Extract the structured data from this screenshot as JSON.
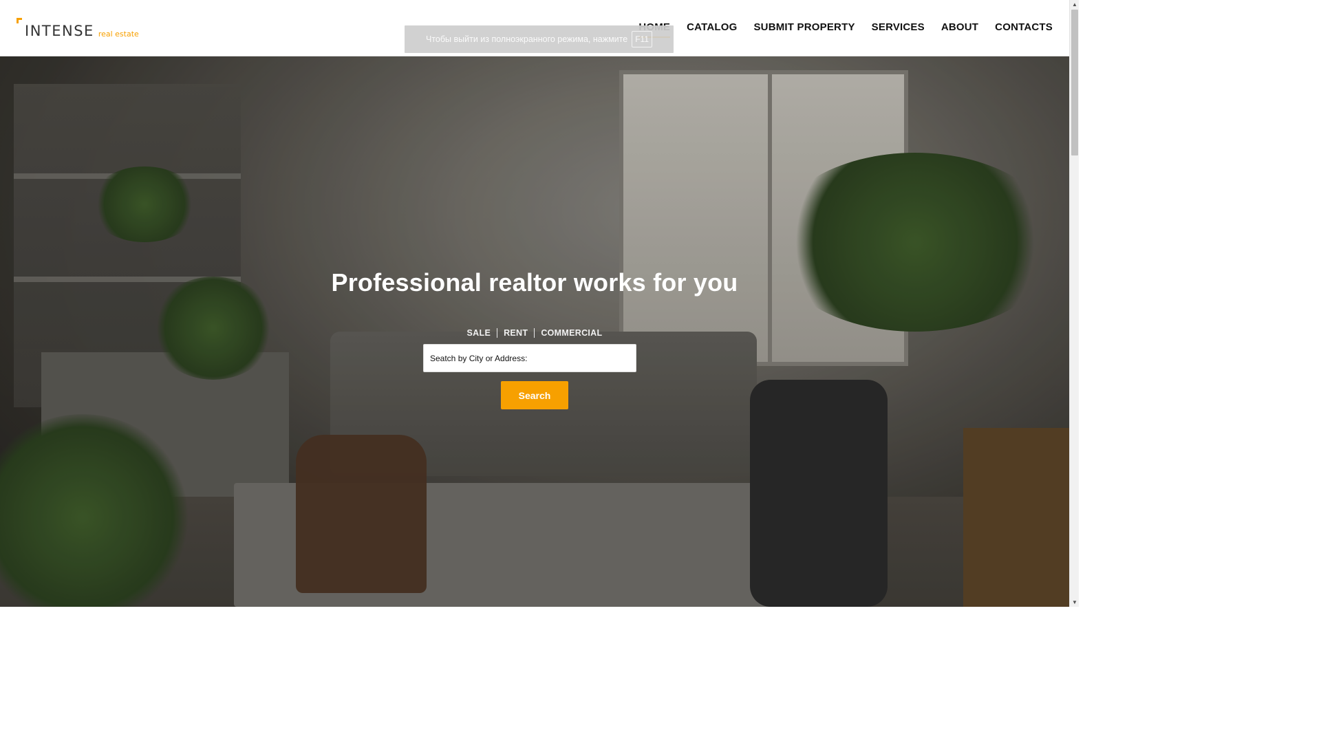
{
  "header": {
    "logo_main": "INTENSE",
    "logo_sub": "real estate",
    "nav": [
      {
        "label": "HOME",
        "active": true
      },
      {
        "label": "CATALOG",
        "active": false
      },
      {
        "label": "SUBMIT PROPERTY",
        "active": false
      },
      {
        "label": "SERVICES",
        "active": false
      },
      {
        "label": "ABOUT",
        "active": false
      },
      {
        "label": "CONTACTS",
        "active": false
      }
    ],
    "fullscreen_hint": {
      "text": "Чтобы выйти из полноэкранного режима, нажмите",
      "key": "F11"
    }
  },
  "hero": {
    "title": "Professional realtor works for you",
    "tabs": [
      "SALE",
      "RENT",
      "COMMERCIAL"
    ],
    "search_placeholder": "Seatch by City or Address:",
    "search_button": "Search"
  },
  "colors": {
    "accent": "#f7a000",
    "nav_text": "#111111",
    "hero_text": "#ffffff"
  },
  "icons": {
    "scroll_up": "scroll-up-arrow-icon",
    "scroll_down": "scroll-down-arrow-icon"
  }
}
